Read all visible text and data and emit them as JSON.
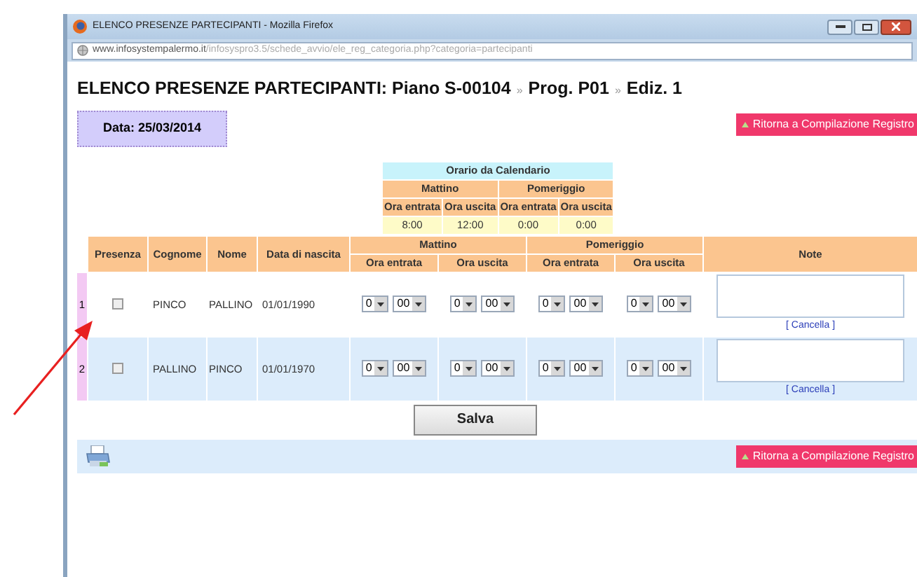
{
  "window": {
    "title": "ELENCO PRESENZE PARTECIPANTI - Mozilla Firefox",
    "url_domain": "www.infosystempalermo.it",
    "url_path": "/infosyspro3.5/schede_avvio/ele_reg_categoria.php?categoria=partecipanti"
  },
  "heading": {
    "title": "ELENCO PRESENZE PARTECIPANTI: Piano S-00104",
    "crumbs": [
      {
        "separator": "»",
        "label": "Prog. P01"
      },
      {
        "separator": "»",
        "label": "Ediz. 1"
      }
    ]
  },
  "date_label": "Data: 25/03/2014",
  "return_button": "Ritorna a Compilazione Registro",
  "calendar": {
    "title": "Orario da Calendario",
    "groups": [
      "Mattino",
      "Pomeriggio"
    ],
    "columns": [
      "Ora entrata",
      "Ora uscita",
      "Ora entrata",
      "Ora uscita"
    ],
    "values": [
      "8:00",
      "12:00",
      "0:00",
      "0:00"
    ]
  },
  "table": {
    "columns": [
      "Presenza",
      "Cognome",
      "Nome",
      "Data di nascita"
    ],
    "groups": [
      "Mattino",
      "Pomeriggio"
    ],
    "time_columns": [
      "Ora entrata",
      "Ora uscita",
      "Ora entrata",
      "Ora uscita"
    ],
    "note_column": "Note",
    "rows": [
      {
        "number": "1",
        "checked": false,
        "cognome": "PINCO",
        "nome": "PALLINO",
        "birth_date": "01/01/1990",
        "times": [
          {
            "hour": "0",
            "minute": "00"
          },
          {
            "hour": "0",
            "minute": "00"
          },
          {
            "hour": "0",
            "minute": "00"
          },
          {
            "hour": "0",
            "minute": "00"
          }
        ],
        "note_link": "[ Cancella ]"
      },
      {
        "number": "2",
        "checked": false,
        "cognome": "PALLINO",
        "nome": "PINCO",
        "birth_date": "01/01/1970",
        "times": [
          {
            "hour": "0",
            "minute": "00"
          },
          {
            "hour": "0",
            "minute": "00"
          },
          {
            "hour": "0",
            "minute": "00"
          },
          {
            "hour": "0",
            "minute": "00"
          }
        ],
        "note_link": "[ Cancella ]"
      }
    ]
  },
  "save_button": "Salva",
  "footer": {
    "return_button": "Ritorna a Compilazione Registro"
  }
}
